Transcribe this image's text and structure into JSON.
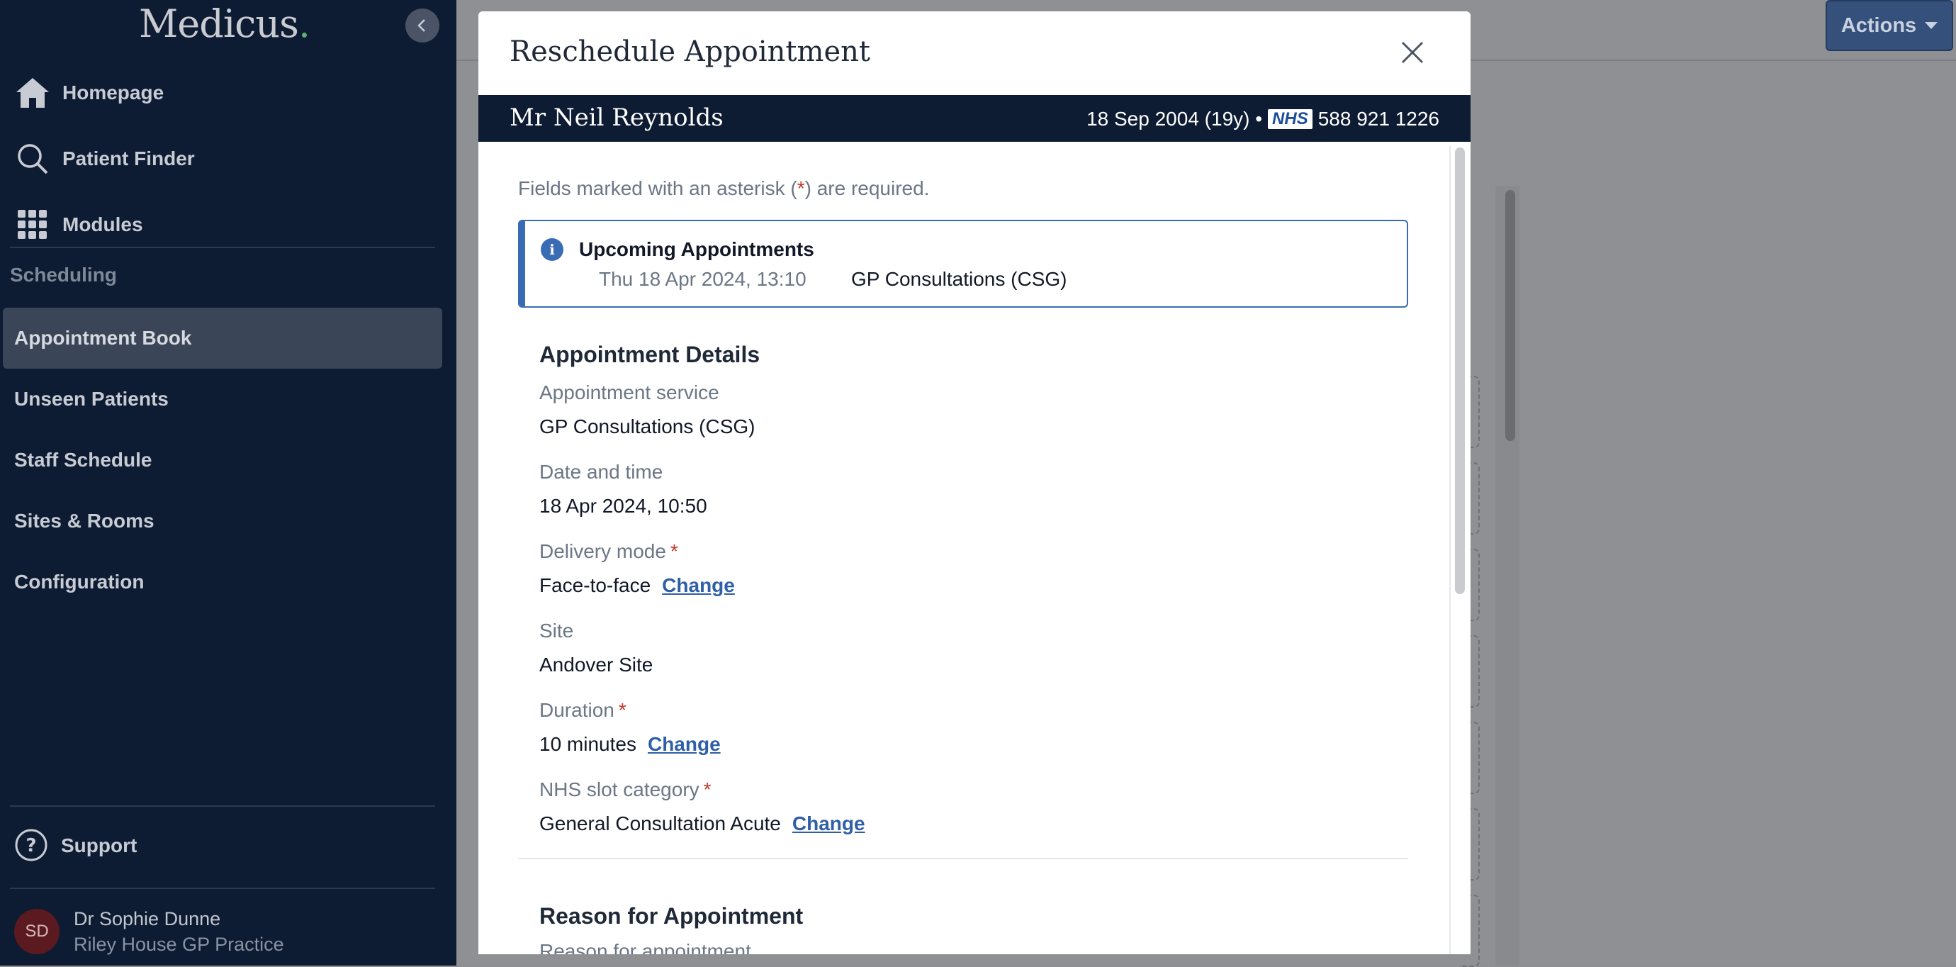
{
  "sidebar": {
    "logo": "Medicus",
    "logo_dot": ".",
    "nav": [
      {
        "label": "Homepage",
        "icon": "home-icon"
      },
      {
        "label": "Patient Finder",
        "icon": "search-icon"
      },
      {
        "label": "Modules",
        "icon": "grid-icon"
      }
    ],
    "section": "Scheduling",
    "subnav": [
      {
        "label": "Appointment Book",
        "active": true
      },
      {
        "label": "Unseen Patients"
      },
      {
        "label": "Staff Schedule"
      },
      {
        "label": "Sites & Rooms"
      },
      {
        "label": "Configuration"
      }
    ],
    "support": "Support",
    "user": {
      "initials": "SD",
      "name": "Dr Sophie Dunne",
      "practice": "Riley House GP Practice"
    }
  },
  "header": {
    "actions_label": "Actions"
  },
  "modal": {
    "title": "Reschedule Appointment",
    "patient": {
      "name": "Mr Neil Reynolds",
      "dob": "18 Sep 2004 (19y) •",
      "nhs_logo": "NHS",
      "nhs_number": "588 921 1226"
    },
    "required_note": {
      "before": "Fields marked with an asterisk (",
      "asterisk": "*",
      "after": ") are required."
    },
    "upcoming": {
      "title": "Upcoming Appointments",
      "date": "Thu 18 Apr 2024, 13:10",
      "service": "GP Consultations (CSG)"
    },
    "details": {
      "title": "Appointment Details",
      "service_label": "Appointment service",
      "service_value": "GP Consultations (CSG)",
      "datetime_label": "Date and time",
      "datetime_value": "18 Apr 2024, 10:50",
      "delivery_label": "Delivery mode",
      "delivery_value": "Face-to-face",
      "site_label": "Site",
      "site_value": "Andover Site",
      "duration_label": "Duration",
      "duration_value": "10 minutes",
      "slot_label": "NHS slot category",
      "slot_value": "General Consultation Acute",
      "change_label": "Change",
      "asterisk": "*"
    },
    "reason": {
      "title": "Reason for Appointment",
      "label": "Reason for appointment"
    }
  },
  "colors": {
    "sidebar_bg": "#0d1b33",
    "accent": "#3a6bb5",
    "link": "#2f5fa7",
    "required": "#c0392b"
  }
}
